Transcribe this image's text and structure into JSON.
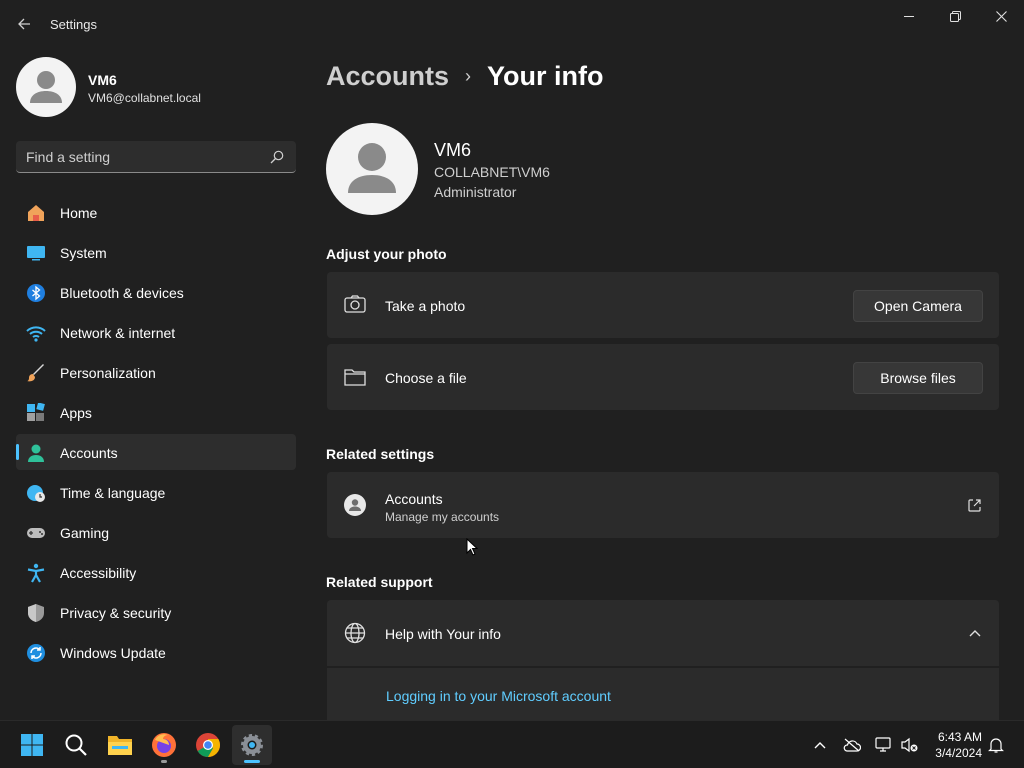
{
  "window": {
    "title": "Settings",
    "controls": {
      "minimize": "minimize-icon",
      "maximize": "restore-icon",
      "close": "close-icon"
    }
  },
  "profile": {
    "name": "VM6",
    "email": "VM6@collabnet.local"
  },
  "search": {
    "placeholder": "Find a setting",
    "value": ""
  },
  "sidebar": {
    "active": "Accounts",
    "accent_color": "#4cc2ff",
    "items": [
      {
        "label": "Home",
        "icon": "home-icon"
      },
      {
        "label": "System",
        "icon": "system-icon"
      },
      {
        "label": "Bluetooth & devices",
        "icon": "bluetooth-icon"
      },
      {
        "label": "Network & internet",
        "icon": "wifi-icon"
      },
      {
        "label": "Personalization",
        "icon": "brush-icon"
      },
      {
        "label": "Apps",
        "icon": "apps-icon"
      },
      {
        "label": "Accounts",
        "icon": "accounts-icon"
      },
      {
        "label": "Time & language",
        "icon": "globe-clock-icon"
      },
      {
        "label": "Gaming",
        "icon": "gamepad-icon"
      },
      {
        "label": "Accessibility",
        "icon": "accessibility-icon"
      },
      {
        "label": "Privacy & security",
        "icon": "shield-icon"
      },
      {
        "label": "Windows Update",
        "icon": "update-icon"
      }
    ]
  },
  "breadcrumb": {
    "parent": "Accounts",
    "separator": "›",
    "current": "Your info"
  },
  "user": {
    "name": "VM6",
    "domain": "COLLABNET\\VM6",
    "role": "Administrator"
  },
  "photo": {
    "heading": "Adjust your photo",
    "take_photo": {
      "label": "Take a photo",
      "button": "Open Camera"
    },
    "choose_file": {
      "label": "Choose a file",
      "button": "Browse files"
    }
  },
  "related_settings": {
    "heading": "Related settings",
    "accounts": {
      "title": "Accounts",
      "subtitle": "Manage my accounts"
    }
  },
  "related_support": {
    "heading": "Related support",
    "help": {
      "title": "Help with Your info",
      "expanded": true
    },
    "link": "Logging in to your Microsoft account",
    "link_color": "#60cdff"
  },
  "taskbar": {
    "apps": [
      "start-icon",
      "search-icon",
      "file-explorer-icon",
      "firefox-icon",
      "chrome-icon",
      "settings-icon"
    ],
    "active_app": "settings-icon",
    "clock": {
      "time": "6:43 AM",
      "date": "3/4/2024"
    }
  }
}
